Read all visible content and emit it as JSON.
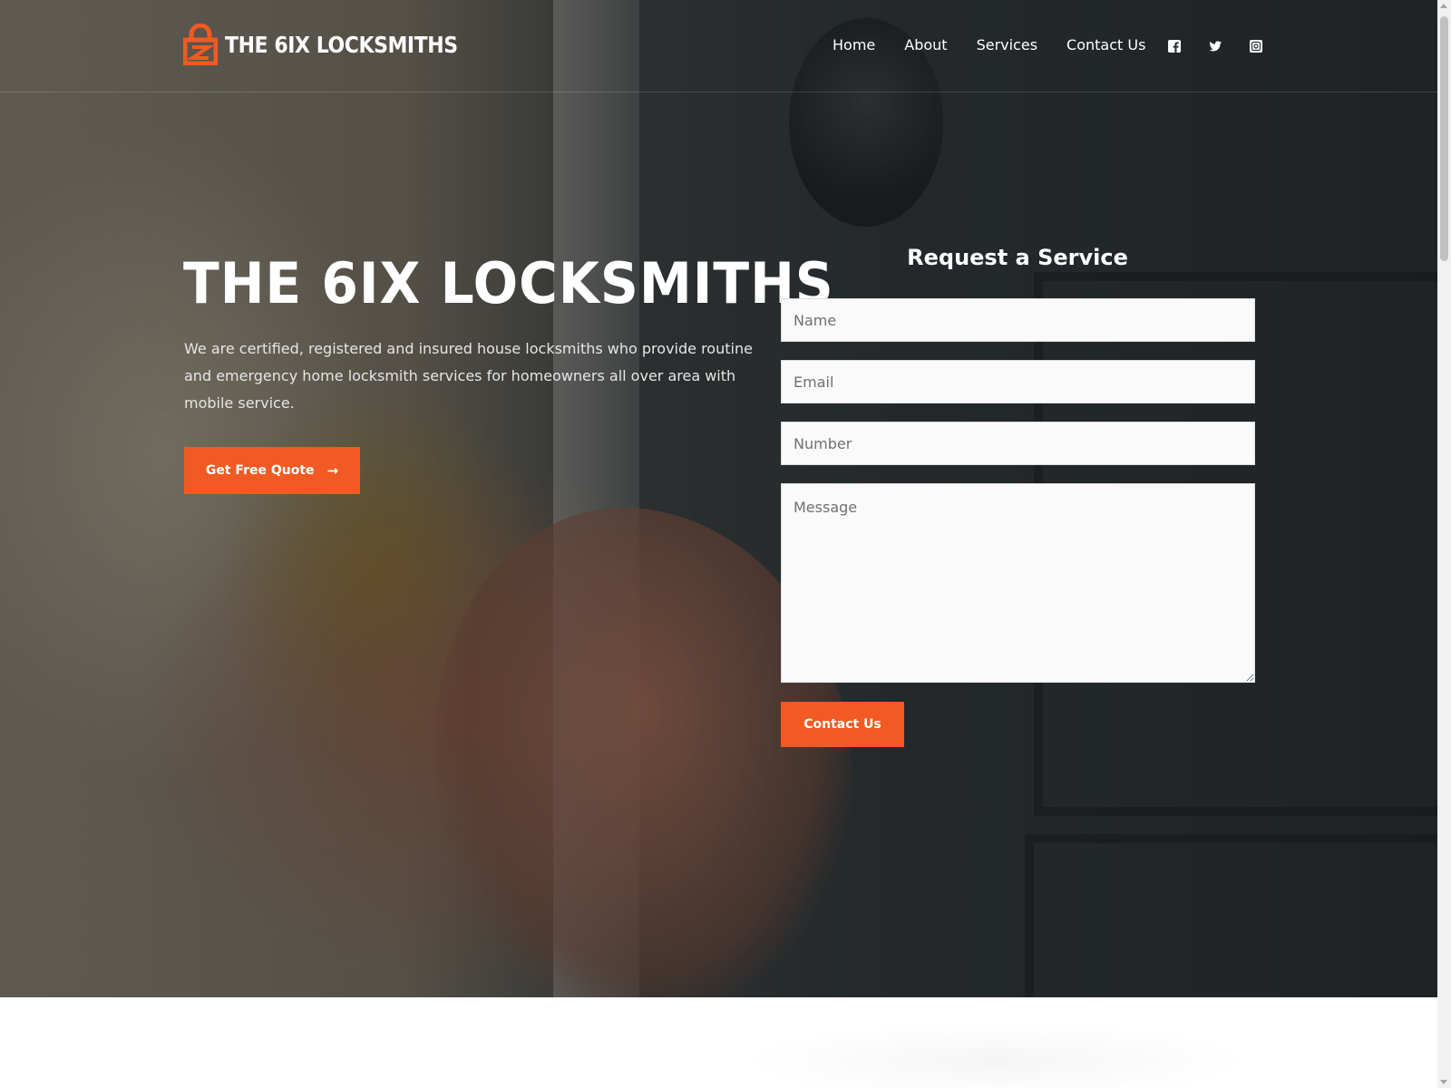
{
  "colors": {
    "accent": "#f15a22",
    "text_on_dark": "#ffffff",
    "field_bg": "#fafafa"
  },
  "header": {
    "logo_icon": "padlock-logo-icon",
    "logo_text": "THE 6IX LOCKSMITHS",
    "nav": [
      "Home",
      "About",
      "Services",
      "Contact Us"
    ],
    "social_icons": [
      "facebook-icon",
      "twitter-icon",
      "instagram-icon"
    ]
  },
  "hero": {
    "title": "THE 6IX LOCKSMITHS",
    "description": "We are certified, registered and insured house locksmiths who provide routine and emergency home locksmith services for homeowners all over area with mobile service.",
    "cta_label": "Get Free Quote",
    "cta_icon": "arrow-right-icon"
  },
  "form": {
    "title": "Request a Service",
    "name_placeholder": "Name",
    "email_placeholder": "Email",
    "number_placeholder": "Number",
    "message_placeholder": "Message",
    "submit_label": "Contact Us"
  }
}
